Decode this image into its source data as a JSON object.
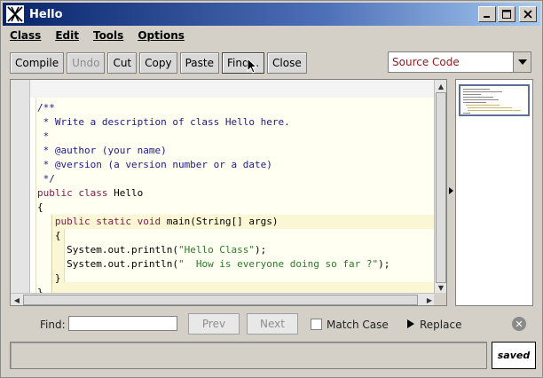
{
  "window": {
    "title": "Hello",
    "icon": "blue-j-logo-icon",
    "controls": [
      "minimize-icon",
      "maximize-icon",
      "close-icon"
    ]
  },
  "menubar": {
    "items": [
      "Class",
      "Edit",
      "Tools",
      "Options"
    ]
  },
  "toolbar": {
    "compile": "Compile",
    "undo": "Undo",
    "cut": "Cut",
    "copy": "Copy",
    "paste": "Paste",
    "find": "Find...",
    "close": "Close"
  },
  "view_selector": {
    "selected": "Source Code",
    "color": "#8b1a1a"
  },
  "editor": {
    "lines": [
      {
        "text": "/**",
        "kind": "comment"
      },
      {
        "text": " * Write a description of class Hello here.",
        "kind": "comment"
      },
      {
        "text": " *",
        "kind": "comment"
      },
      {
        "text": " * @author (your name)",
        "kind": "comment"
      },
      {
        "text": " * @version (a version number or a date)",
        "kind": "comment"
      },
      {
        "text": " */",
        "kind": "comment"
      },
      {
        "parts": [
          {
            "t": "public class ",
            "k": "kw"
          },
          {
            "t": "Hello",
            "k": "plain"
          }
        ]
      },
      {
        "text": "{",
        "kind": "plain"
      },
      {
        "parts": [
          {
            "t": "   public static void ",
            "k": "kw"
          },
          {
            "t": "main(String[] args)",
            "k": "plain"
          }
        ]
      },
      {
        "text": "   {",
        "kind": "plain"
      },
      {
        "parts": [
          {
            "t": "     System.out.println(",
            "k": "plain"
          },
          {
            "t": "\"Hello Class\"",
            "k": "str"
          },
          {
            "t": ");",
            "k": "plain"
          }
        ]
      },
      {
        "parts": [
          {
            "t": "     System.out.println(",
            "k": "plain"
          },
          {
            "t": "\"  How is everyone doing so far ?\"",
            "k": "str"
          },
          {
            "t": ");",
            "k": "plain"
          }
        ]
      },
      {
        "text": "   }",
        "kind": "plain"
      },
      {
        "text": "}",
        "kind": "plain"
      }
    ],
    "colors": {
      "comment": "#1a1a8c",
      "keyword": "#7a1a4a",
      "string": "#2a7a2a"
    }
  },
  "findbar": {
    "label": "Find:",
    "value": "",
    "prev": "Prev",
    "next": "Next",
    "match_case": "Match Case",
    "match_case_checked": false,
    "replace": "Replace"
  },
  "status": {
    "message": "",
    "saved": "saved"
  }
}
